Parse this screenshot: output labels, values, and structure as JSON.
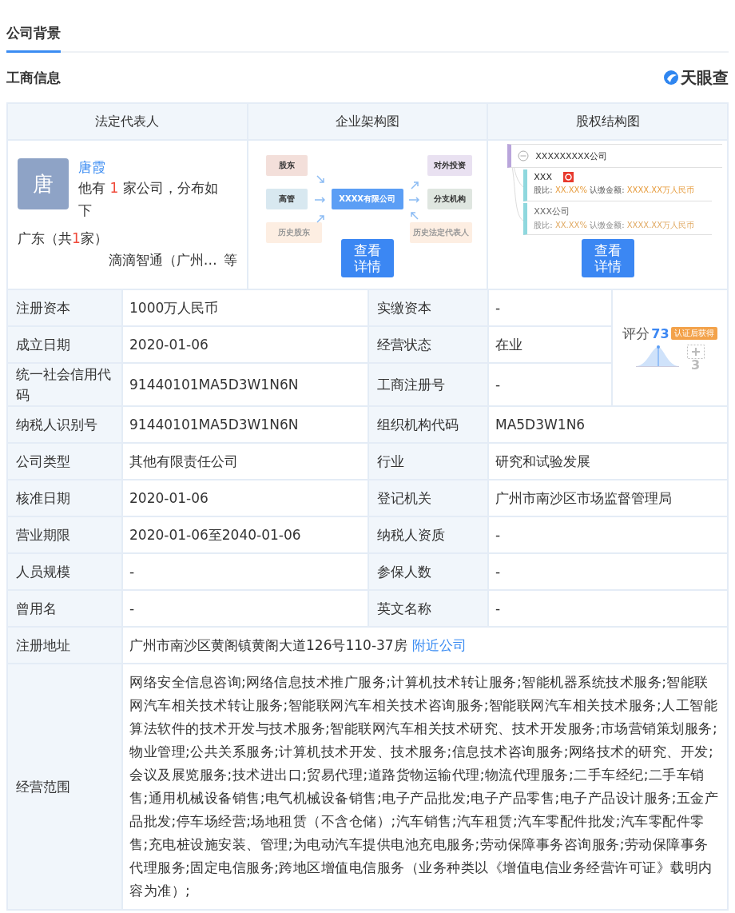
{
  "tabs": [
    {
      "label": "公司背景",
      "selected": true
    }
  ],
  "section": {
    "title": "工商信息",
    "logo": "天眼查"
  },
  "summary_columns": [
    "法定代表人",
    "企业架构图",
    "股权结构图"
  ],
  "legal_rep": {
    "avatar": "唐",
    "name": "唐霞",
    "text_before": "他有",
    "count": "1",
    "text_after": "家公司，分布如下",
    "region_before": "广东（共",
    "region_count": "1",
    "region_after": "家）",
    "company": "滴滴智通（广州…",
    "more": "等"
  },
  "org_chart": {
    "nodes": [
      {
        "label": "股东",
        "kind": "left",
        "color": "#f3dfda",
        "faded": false
      },
      {
        "label": "高管",
        "kind": "left",
        "color": "#d8e8f0",
        "faded": false
      },
      {
        "label": "历史股东",
        "kind": "left",
        "color": "#fdeee2",
        "faded": true
      },
      {
        "label": "XXXX有限公司",
        "kind": "center",
        "color": "#5b9ef5",
        "faded": false
      },
      {
        "label": "对外投资",
        "kind": "right",
        "color": "#e9e1f1",
        "faded": false
      },
      {
        "label": "分支机构",
        "kind": "right",
        "color": "#dfe6e0",
        "faded": false
      },
      {
        "label": "历史法定代表人",
        "kind": "right",
        "color": "#fdeee2",
        "faded": true
      }
    ],
    "button": "查看详情"
  },
  "equity": {
    "root": "XXXXXXXXX公司",
    "holders": [
      {
        "name": "XXX",
        "marker": true,
        "faded": false,
        "ratio_label": "股比:",
        "ratio": "XX.XX%",
        "amount_label": "认缴金额:",
        "amount": "XXXX.XX万人民币",
        "color": "#8fd8de"
      },
      {
        "name": "XXX公司",
        "marker": false,
        "faded": true,
        "ratio_label": "股比:",
        "ratio": "XX.XX%",
        "amount_label": "认缴金额:",
        "amount": "XXXX.XX万人民币",
        "color": "#8fd8de"
      }
    ],
    "button": "查看详情"
  },
  "score": {
    "label": "评分",
    "value": "73",
    "badge": "认证后获得",
    "count": "3"
  },
  "rows": [
    {
      "kind": "pair",
      "label": "注册资本",
      "value": "1000万人民币",
      "label2": "实缴资本",
      "value2": "-"
    },
    {
      "kind": "pair",
      "label": "成立日期",
      "value": "2020-01-06",
      "label2": "经营状态",
      "value2": "在业"
    },
    {
      "kind": "pair",
      "label": "统一社会信用代码",
      "value": "91440101MA5D3W1N6N",
      "label2": "工商注册号",
      "value2": "-"
    },
    {
      "kind": "pair",
      "label": "纳税人识别号",
      "value": "91440101MA5D3W1N6N",
      "label2": "组织机构代码",
      "value2": "MA5D3W1N6"
    },
    {
      "kind": "pair",
      "label": "公司类型",
      "value": "其他有限责任公司",
      "label2": "行业",
      "value2": "研究和试验发展"
    },
    {
      "kind": "pair",
      "label": "核准日期",
      "value": "2020-01-06",
      "label2": "登记机关",
      "value2": "广州市南沙区市场监督管理局"
    },
    {
      "kind": "pair",
      "label": "营业期限",
      "value": "2020-01-06至2040-01-06",
      "label2": "纳税人资质",
      "value2": "-"
    },
    {
      "kind": "pair",
      "label": "人员规模",
      "value": "-",
      "label2": "参保人数",
      "value2": "-"
    },
    {
      "kind": "pair",
      "label": "曾用名",
      "value": "-",
      "label2": "英文名称",
      "value2": "-"
    },
    {
      "kind": "address",
      "label": "注册地址",
      "value": "广州市南沙区黄阁镇黄阁大道126号110-37房",
      "link": "附近公司"
    },
    {
      "kind": "long",
      "label": "经营范围",
      "value": "网络安全信息咨询;网络信息技术推广服务;计算机技术转让服务;智能机器系统技术服务;智能联网汽车相关技术转让服务;智能联网汽车相关技术咨询服务;智能联网汽车相关技术服务;人工智能算法软件的技术开发与技术服务;智能联网汽车相关技术研究、技术开发服务;市场营销策划服务;物业管理;公共关系服务;计算机技术开发、技术服务;信息技术咨询服务;网络技术的研究、开发;会议及展览服务;技术进出口;贸易代理;道路货物运输代理;物流代理服务;二手车经纪;二手车销售;通用机械设备销售;电气机械设备销售;电子产品批发;电子产品零售;电子产品设计服务;五金产品批发;停车场经营;场地租赁（不含仓储）;汽车销售;汽车租赁;汽车零配件批发;汽车零配件零售;充电桩设施安装、管理;为电动汽车提供电池充电服务;劳动保障事务咨询服务;劳动保障事务代理服务;固定电信服务;跨地区增值电信服务（业务种类以《增值电信业务经营许可证》载明内容为准）;"
    }
  ]
}
